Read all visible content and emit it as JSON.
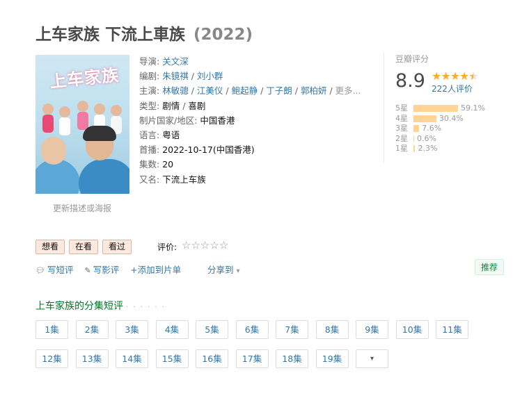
{
  "title": {
    "main": "上车家族 下流上車族",
    "year": "(2022)"
  },
  "poster": {
    "text": "上车家族",
    "update_link": "更新描述或海报"
  },
  "info": {
    "director_label": "导演:",
    "director": "关文深",
    "writer_label": "编剧:",
    "writer1": "朱镜祺",
    "writer2": "刘小群",
    "cast_label": "主演:",
    "cast": [
      "林敏骢",
      "江美仪",
      "鲍起静",
      "丁子朗",
      "郭柏妍"
    ],
    "cast_more": "更多...",
    "genre_label": "类型:",
    "genre1": "剧情",
    "genre2": "喜剧",
    "region_label": "制片国家/地区:",
    "region": "中国香港",
    "language_label": "语言:",
    "language": "粤语",
    "premiere_label": "首播:",
    "premiere": "2022-10-17(中国香港)",
    "episodes_label": "集数:",
    "episodes": "20",
    "aka_label": "又名:",
    "aka": "下流上车族",
    "separator": " / "
  },
  "rating": {
    "label": "豆瓣评分",
    "score": "8.9",
    "votes": "222人评价",
    "stars_value": 4.5,
    "bars": [
      {
        "label": "5星",
        "pct": "59.1%",
        "value": 59.1
      },
      {
        "label": "4星",
        "pct": "30.4%",
        "value": 30.4
      },
      {
        "label": "3星",
        "pct": "7.6%",
        "value": 7.6
      },
      {
        "label": "2星",
        "pct": "0.6%",
        "value": 0.6
      },
      {
        "label": "1星",
        "pct": "2.3%",
        "value": 2.3
      }
    ]
  },
  "buttons": {
    "want": "想看",
    "watching": "在看",
    "watched": "看过"
  },
  "rate": {
    "label": "评价:",
    "stars": "☆☆☆☆☆"
  },
  "actions": {
    "short_review": "写短评",
    "review": "写影评",
    "add_list": "+添加到片单",
    "share": "分享到"
  },
  "recommend": "推荐",
  "section": {
    "title": "上车家族的分集短评",
    "dots": "· · · · · ·"
  },
  "episodes": [
    "1集",
    "2集",
    "3集",
    "4集",
    "5集",
    "6集",
    "7集",
    "8集",
    "9集",
    "10集",
    "11集",
    "12集",
    "13集",
    "14集",
    "15集",
    "16集",
    "17集",
    "18集",
    "19集"
  ],
  "more_episodes": "▾",
  "colors": {
    "link": "#37a",
    "green": "#007722",
    "star": "#ffac2d",
    "bar": "#ffd596",
    "button_bg": "#fde9de"
  }
}
